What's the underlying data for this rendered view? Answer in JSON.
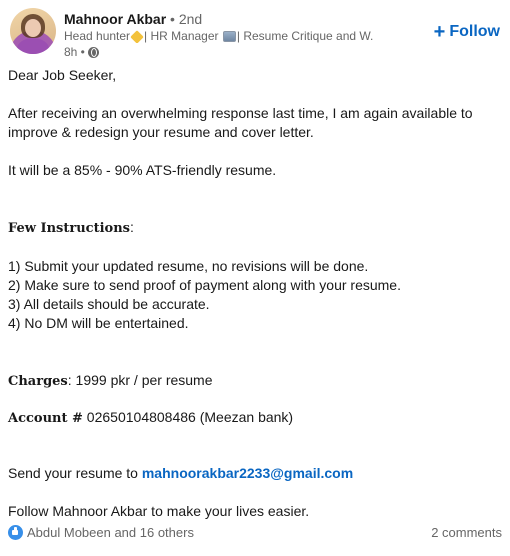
{
  "author": {
    "name": "Mahnoor Akbar",
    "degree": "• 2nd",
    "headline_part1": "Head hunter",
    "headline_part2": "| HR Manager",
    "headline_part3": "| Resume Critique and W...",
    "time": "8h •",
    "icons": [
      "star-emoji-icon",
      "frame-emoji-icon",
      "globe-icon"
    ]
  },
  "follow": {
    "plus": "+",
    "label": "Follow"
  },
  "post": {
    "greeting": "Dear Job Seeker,",
    "intro": "After receiving an overwhelming response last time, I am again available to improve & redesign your resume and cover letter.",
    "ats": "It will be a 85% - 90% ATS-friendly resume.",
    "instructions_title": "Few Instructions",
    "instructions_colon": ":",
    "instructions": [
      "1) Submit your updated resume, no revisions will be done.",
      "2) Make sure to send proof of payment along with your resume.",
      "3) All details should be accurate.",
      "4) No DM will be entertained."
    ],
    "charges_label": "Charges",
    "charges_value": ": 1999 pkr / per resume",
    "account_label": "Account #",
    "account_value": " 02650104808486 (Meezan bank)",
    "send_text": "Send your resume to ",
    "email": "mahnoorakbar2233@gmail.com",
    "closing": "Follow Mahnoor Akbar to make your lives easier."
  },
  "reactions": {
    "text": "Abdul Mobeen and 16 others",
    "comments": "2 comments",
    "icon": "like-icon"
  },
  "colors": {
    "accent": "#0a66c2",
    "muted": "#666666",
    "text": "#191919",
    "like": "#378fe9"
  }
}
